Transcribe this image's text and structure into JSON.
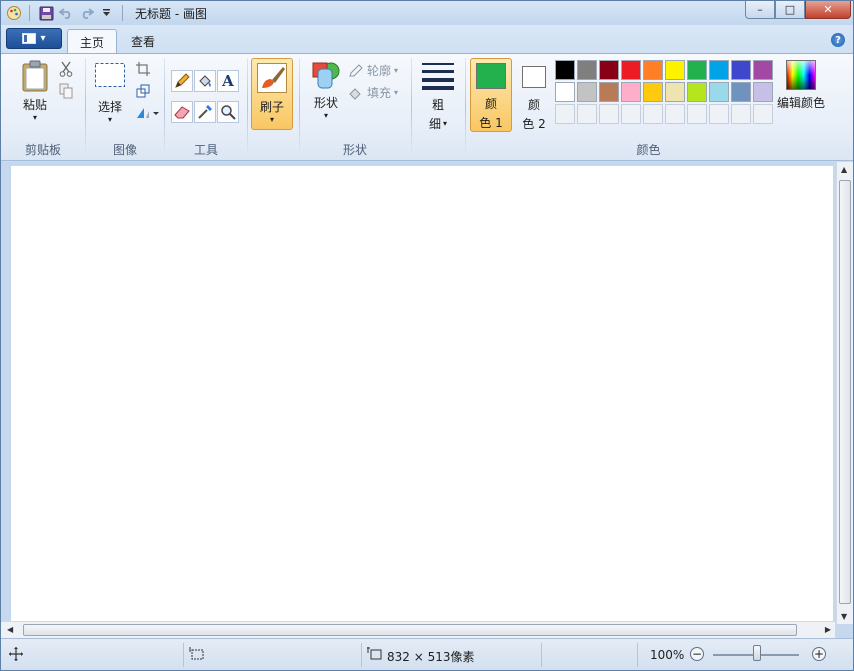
{
  "window": {
    "title": "无标题 - 画图",
    "minimize": "–",
    "maximize": "□",
    "close": "✕"
  },
  "tabs": {
    "home": "主页",
    "view": "查看",
    "app_menu_arrow": "▾"
  },
  "help": "?",
  "groups": {
    "clipboard": {
      "label": "剪贴板",
      "paste": "粘贴"
    },
    "image": {
      "label": "图像",
      "select": "选择"
    },
    "tools": {
      "label": "工具",
      "text_tool": "A"
    },
    "brushes": {
      "label": "刷子"
    },
    "shapes": {
      "label": "形状",
      "shape_button": "形状",
      "outline": "轮廓",
      "fill": "填充"
    },
    "size": {
      "line1": "粗",
      "line2": "细"
    },
    "colors": {
      "label": "颜色",
      "color1_line1": "颜",
      "color1_line2": "色 1",
      "color2_line1": "颜",
      "color2_line2": "色 2",
      "edit_colors": "编辑颜色",
      "color1_value": "#22b14c",
      "color2_value": "#ffffff",
      "palette_row1": [
        "#000000",
        "#7f7f7f",
        "#880015",
        "#ed1c24",
        "#ff7f27",
        "#fff200",
        "#22b14c",
        "#00a2e8",
        "#3f48cc",
        "#a349a4"
      ],
      "palette_row2": [
        "#ffffff",
        "#c3c3c3",
        "#b97a57",
        "#ffaec9",
        "#ffc90e",
        "#efe4b0",
        "#b5e61d",
        "#99d9ea",
        "#7092be",
        "#c8bfe7"
      ]
    }
  },
  "status": {
    "canvas_size": "832 × 513像素",
    "zoom": "100%",
    "zoom_out": "−",
    "zoom_in": "+"
  }
}
